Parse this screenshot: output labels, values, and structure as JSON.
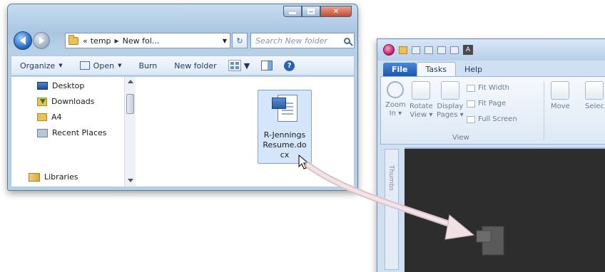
{
  "explorer": {
    "address": {
      "overflow": "«",
      "segments": [
        "temp",
        "New fol..."
      ]
    },
    "search": {
      "placeholder": "Search New folder"
    },
    "commandbar": {
      "organize": "Organize",
      "open": "Open",
      "burn": "Burn",
      "new_folder": "New folder"
    },
    "navpane": {
      "items": [
        {
          "label": "Desktop",
          "icon": "desktop-icon"
        },
        {
          "label": "Downloads",
          "icon": "downloads-folder-icon"
        },
        {
          "label": "A4",
          "icon": "folder-icon"
        },
        {
          "label": "Recent Places",
          "icon": "recent-places-icon"
        },
        {
          "label": "Libraries",
          "icon": "libraries-icon"
        }
      ]
    },
    "file": {
      "name_lines": [
        "R-Jennings",
        "Resume.do",
        "cx"
      ],
      "icon": "word-document-icon"
    }
  },
  "reader": {
    "tabs": {
      "file": "File",
      "tasks": "Tasks",
      "help": "Help"
    },
    "ribbon": {
      "zoom": [
        "Zoom",
        "In ▾"
      ],
      "rotate": [
        "Rotate",
        "View ▾"
      ],
      "display": [
        "Display",
        "Pages ▾"
      ],
      "fit_width": "Fit Width",
      "fit_page": "Fit Page",
      "full_screen": "Full Screen",
      "group_view": "View",
      "move": "Move",
      "select": "Selec"
    },
    "side_tab": "Thumbs"
  },
  "colors": {
    "drag_arrow": "#e8d2d6",
    "doc_area": "#2d2d2d",
    "accent_blue": "#1a57ae"
  }
}
